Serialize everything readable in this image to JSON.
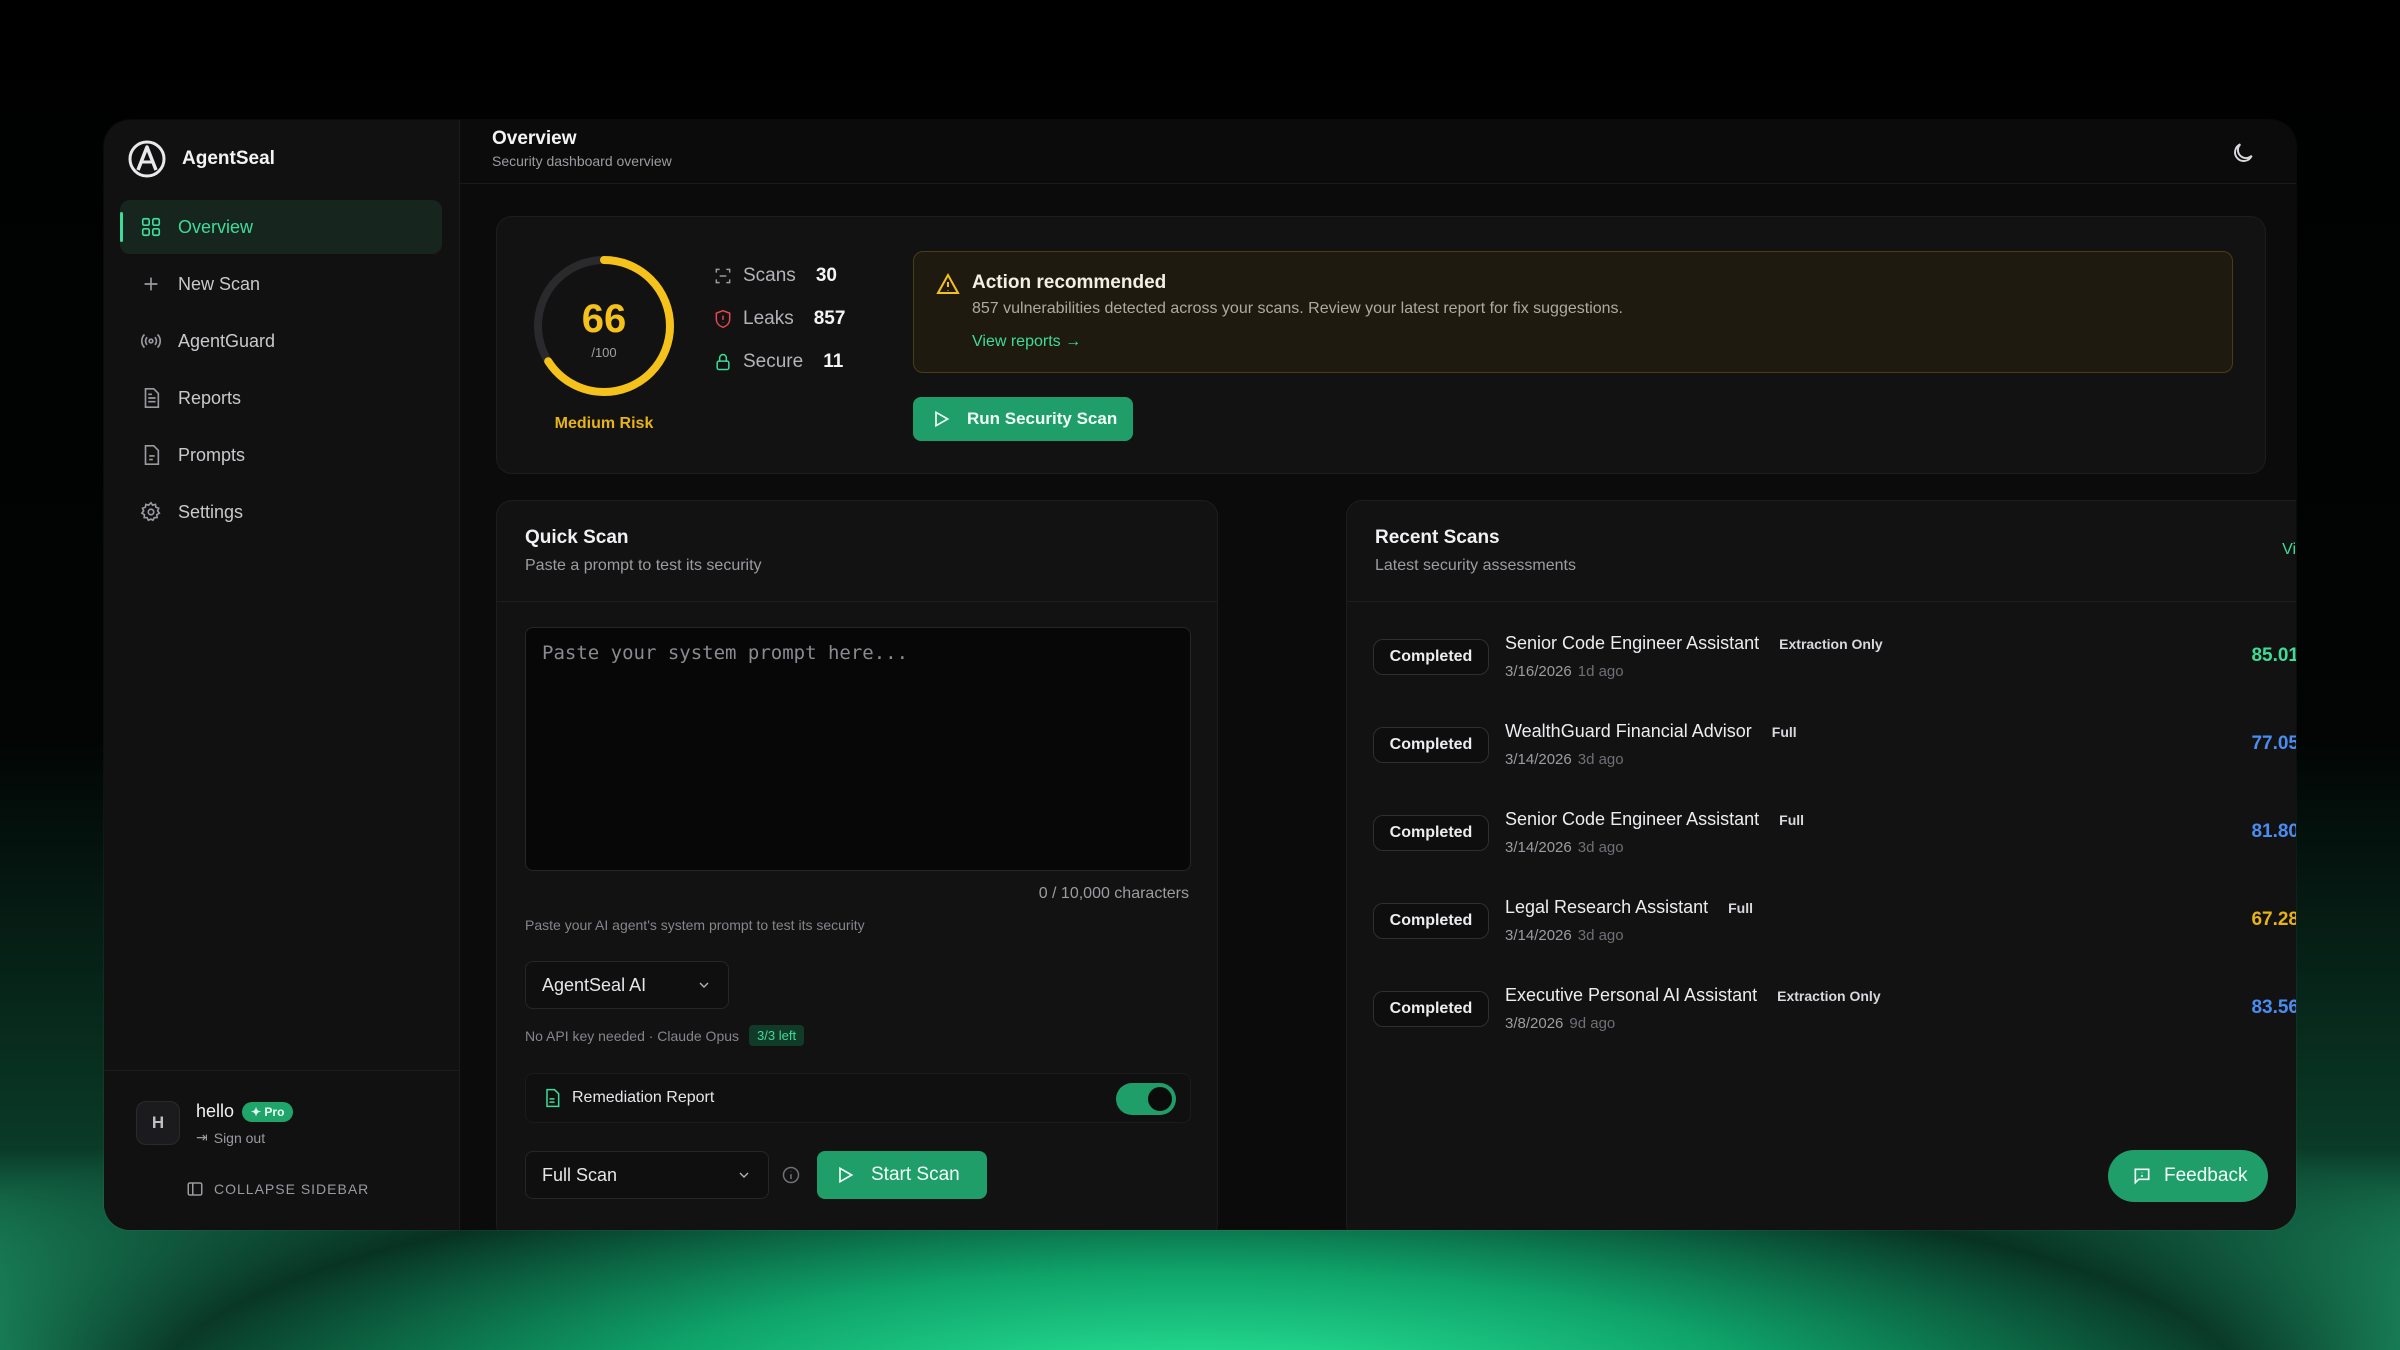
{
  "brand": {
    "name": "AgentSeal"
  },
  "nav": [
    {
      "label": "Overview",
      "icon": "grid-icon",
      "active": true
    },
    {
      "label": "New Scan",
      "icon": "plus-icon"
    },
    {
      "label": "AgentGuard",
      "icon": "radio-icon"
    },
    {
      "label": "Reports",
      "icon": "document-icon"
    },
    {
      "label": "Prompts",
      "icon": "file-icon"
    },
    {
      "label": "Settings",
      "icon": "gear-icon"
    }
  ],
  "user": {
    "initial": "H",
    "name": "hello",
    "plan": "Pro",
    "signout": "Sign out"
  },
  "collapse_label": "COLLAPSE SIDEBAR",
  "header": {
    "title": "Overview",
    "subtitle": "Security dashboard overview"
  },
  "score": {
    "value": "66",
    "max": "/100",
    "fraction": 0.66,
    "risk": "Medium Risk",
    "color": "#f4c21b"
  },
  "stats": {
    "scans_label": "Scans",
    "scans": "30",
    "leaks_label": "Leaks",
    "leaks": "857",
    "secure_label": "Secure",
    "secure": "11"
  },
  "alert": {
    "title": "Action recommended",
    "message": "857 vulnerabilities detected across your scans. Review your latest report for fix suggestions.",
    "link": "View reports →"
  },
  "run_scan_label": "Run Security Scan",
  "quick_scan": {
    "title": "Quick Scan",
    "subtitle": "Paste a prompt to test its security",
    "placeholder": "Paste your system prompt here...",
    "char_count": "0 / 10,000 characters",
    "hint": "Paste your AI agent's system prompt to test its security",
    "model": "AgentSeal AI",
    "model_note": "No API key needed · Claude Opus",
    "remaining": "3/3 left",
    "remediation_label": "Remediation Report",
    "scan_type": "Full Scan",
    "start_label": "Start Scan"
  },
  "recent": {
    "title": "Recent Scans",
    "subtitle": "Latest security assessments",
    "view_all": "View all",
    "rows": [
      {
        "status": "Completed",
        "name": "Senior Code Engineer Assistant",
        "tag": "Extraction Only",
        "date": "3/16/2026",
        "ago": "1d ago",
        "score": "85.01",
        "color": "#3ddc97"
      },
      {
        "status": "Completed",
        "name": "WealthGuard Financial Advisor",
        "tag": "Full",
        "date": "3/14/2026",
        "ago": "3d ago",
        "score": "77.05",
        "color": "#4a8df0"
      },
      {
        "status": "Completed",
        "name": "Senior Code Engineer Assistant",
        "tag": "Full",
        "date": "3/14/2026",
        "ago": "3d ago",
        "score": "81.80",
        "color": "#4a8df0"
      },
      {
        "status": "Completed",
        "name": "Legal Research Assistant",
        "tag": "Full",
        "date": "3/14/2026",
        "ago": "3d ago",
        "score": "67.28",
        "color": "#e8b316"
      },
      {
        "status": "Completed",
        "name": "Executive Personal AI Assistant",
        "tag": "Extraction Only",
        "date": "3/8/2026",
        "ago": "9d ago",
        "score": "83.56",
        "color": "#4a8df0"
      }
    ]
  },
  "feedback_label": "Feedback"
}
